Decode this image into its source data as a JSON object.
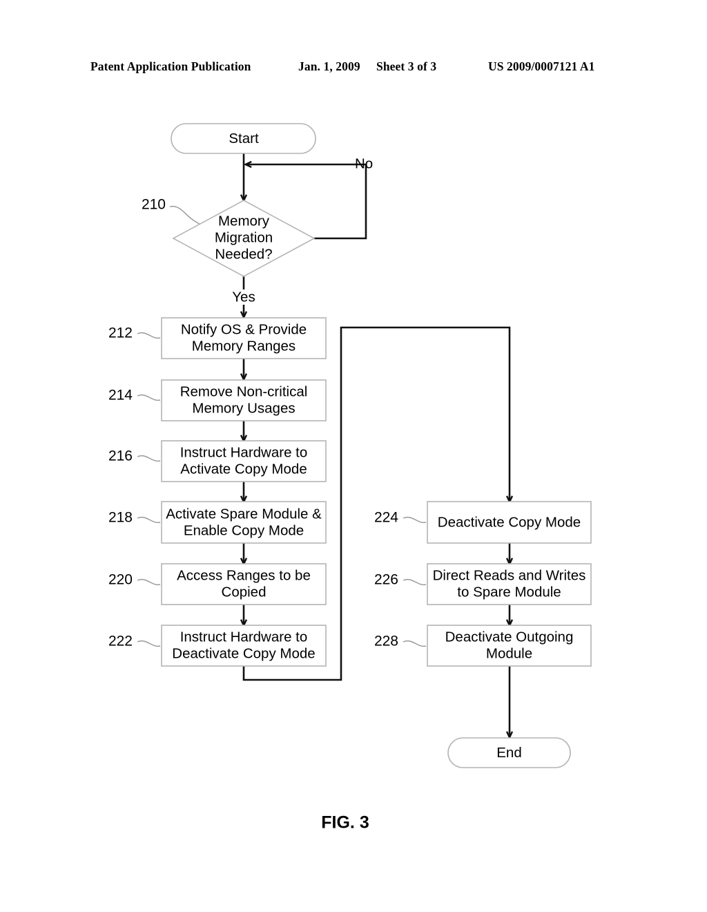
{
  "header": {
    "publication": "Patent Application Publication",
    "date": "Jan. 1, 2009",
    "sheet": "Sheet 3 of 3",
    "patent_number": "US 2009/0007121 A1"
  },
  "figure": {
    "caption": "FIG. 3"
  },
  "flowchart": {
    "terminals": {
      "start": {
        "label": "Start"
      },
      "end": {
        "label": "End"
      }
    },
    "decision": {
      "ref": "210",
      "lines": [
        "Memory",
        "Migration",
        "Needed?"
      ],
      "yes_label": "Yes",
      "no_label": "No"
    },
    "steps": [
      {
        "ref": "212",
        "lines": [
          "Notify OS & Provide",
          "Memory Ranges"
        ],
        "column": "left"
      },
      {
        "ref": "214",
        "lines": [
          "Remove Non-critical",
          "Memory Usages"
        ],
        "column": "left"
      },
      {
        "ref": "216",
        "lines": [
          "Instruct Hardware to",
          "Activate Copy Mode"
        ],
        "column": "left"
      },
      {
        "ref": "218",
        "lines": [
          "Activate Spare Module &",
          "Enable Copy Mode"
        ],
        "column": "left"
      },
      {
        "ref": "220",
        "lines": [
          "Access Ranges to be",
          "Copied"
        ],
        "column": "left"
      },
      {
        "ref": "222",
        "lines": [
          "Instruct Hardware to",
          "Deactivate Copy Mode"
        ],
        "column": "left"
      },
      {
        "ref": "224",
        "lines": [
          "Deactivate Copy Mode"
        ],
        "column": "right"
      },
      {
        "ref": "226",
        "lines": [
          "Direct Reads and Writes",
          "to Spare Module"
        ],
        "column": "right"
      },
      {
        "ref": "228",
        "lines": [
          "Deactivate Outgoing",
          "Module"
        ],
        "column": "right"
      }
    ]
  },
  "colors": {
    "line": "#111111",
    "shape_outline": "#b4b4b4",
    "leader": "#9a9a9a",
    "background": "#ffffff",
    "text": "#000000"
  }
}
